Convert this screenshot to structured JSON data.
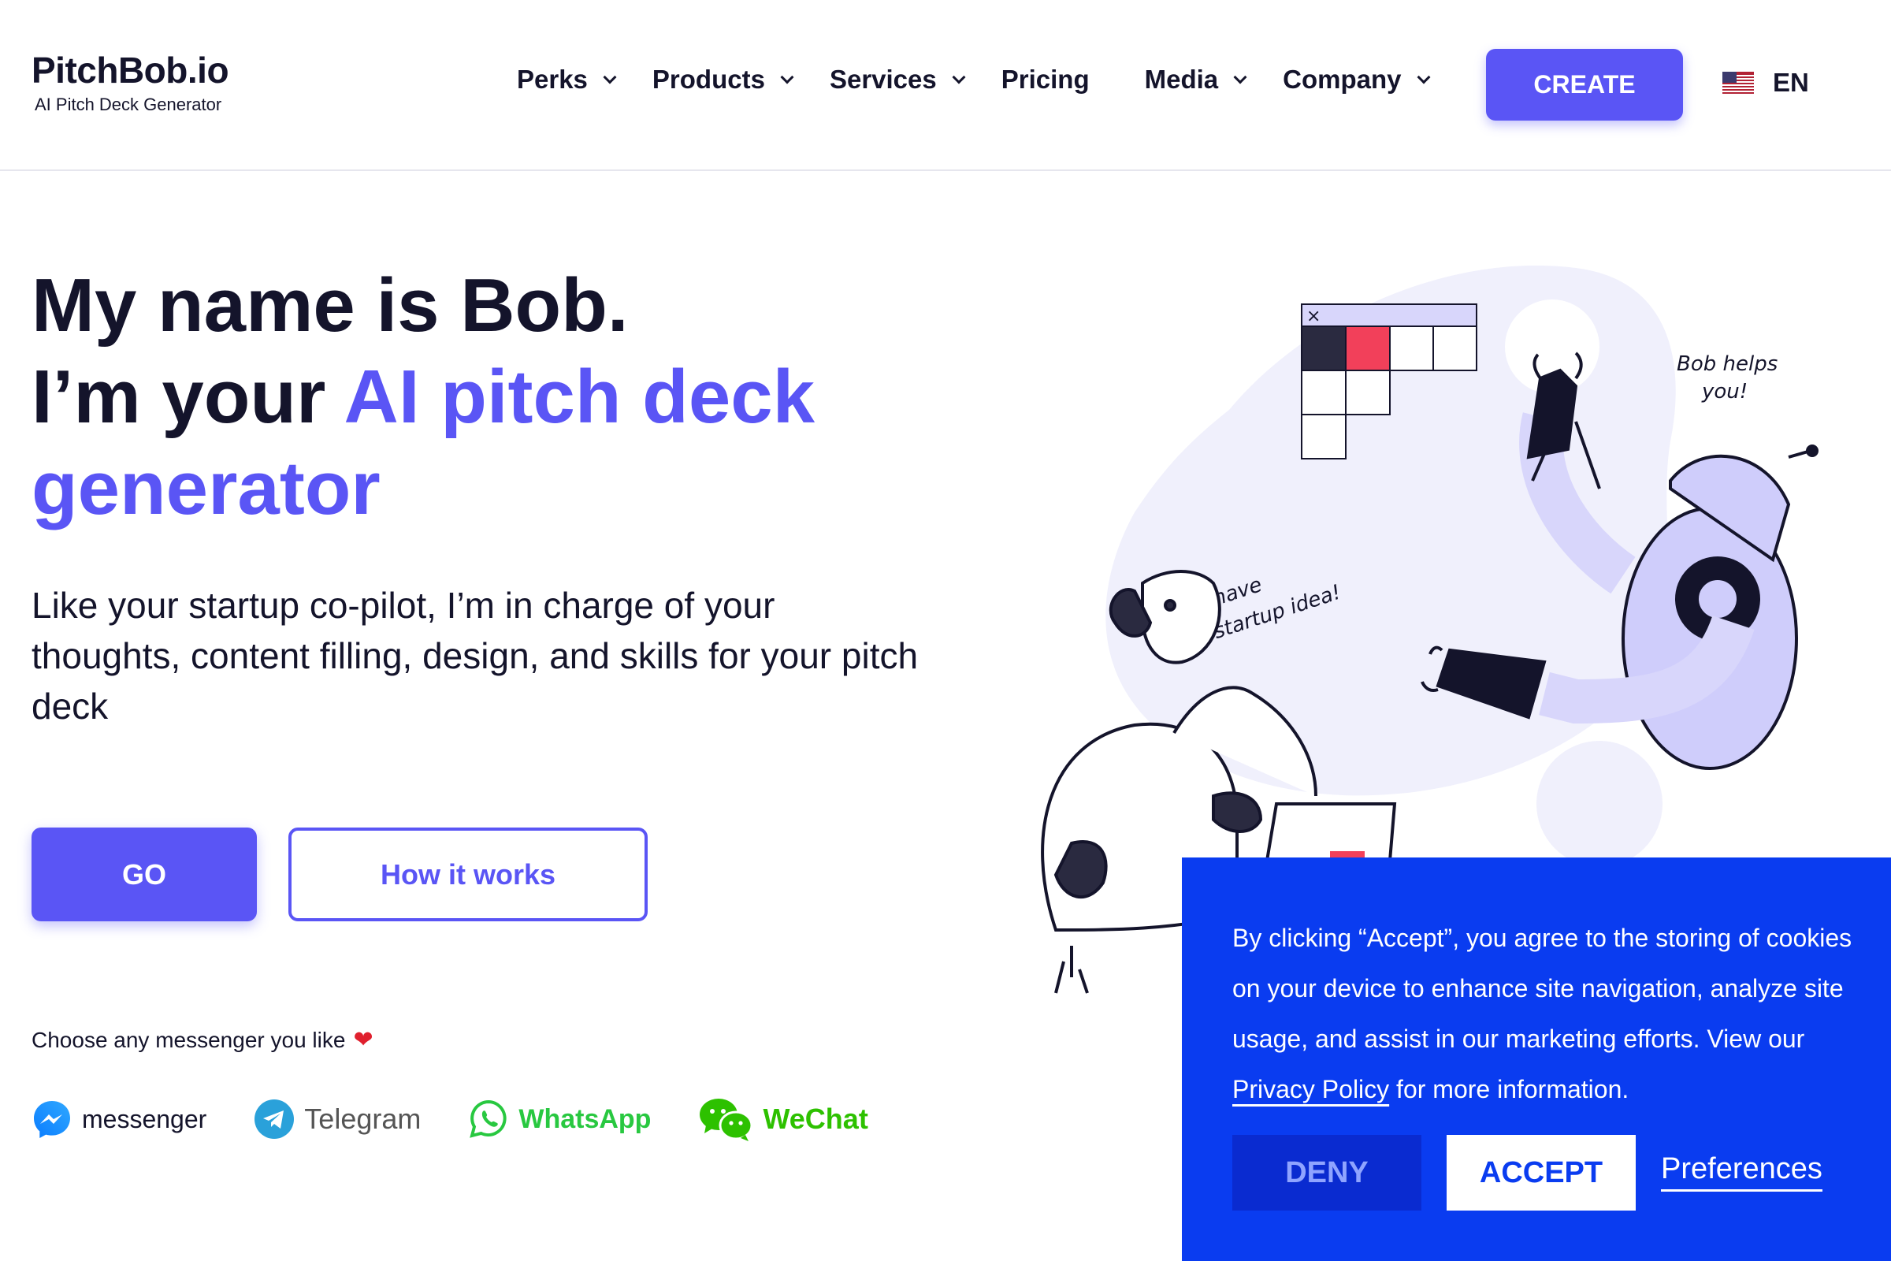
{
  "brand": {
    "name": "PitchBob.io",
    "tagline": "AI Pitch Deck Generator"
  },
  "nav": {
    "items": [
      {
        "label": "Perks",
        "has_dropdown": true
      },
      {
        "label": "Products",
        "has_dropdown": true
      },
      {
        "label": "Services",
        "has_dropdown": true
      },
      {
        "label": "Pricing",
        "has_dropdown": false
      },
      {
        "label": "Media",
        "has_dropdown": true
      },
      {
        "label": "Company",
        "has_dropdown": true
      }
    ],
    "create_label": "CREATE",
    "language": "EN"
  },
  "hero": {
    "line1": "My name is Bob.",
    "line2_prefix": "I’m your ",
    "line2_accent": "AI pitch deck",
    "line3_accent": "generator",
    "description": "Like your startup co-pilot, I’m in charge of your thoughts, content filling, design, and skills for your pitch deck",
    "go_label": "GO",
    "how_label": "How it works"
  },
  "messengers": {
    "note": "Choose any messenger you like",
    "items": [
      {
        "label": "messenger",
        "icon": "facebook-messenger-icon"
      },
      {
        "label": "Telegram",
        "icon": "telegram-icon"
      },
      {
        "label": "WhatsApp",
        "icon": "whatsapp-icon"
      },
      {
        "label": "WeChat",
        "icon": "wechat-icon"
      }
    ]
  },
  "illustration": {
    "bubble_person": "I have a startup idea!",
    "bubble_robot": "Bob helps you!"
  },
  "cookie": {
    "text_before": "By clicking “Accept”, you agree to the storing of cookies on your device to enhance site navigation, analyze site usage, and assist in our marketing efforts. View our ",
    "link": "Privacy Policy",
    "text_after": " for more information.",
    "deny_label": "DENY",
    "accept_label": "ACCEPT",
    "preferences_label": "Preferences"
  },
  "colors": {
    "accent": "#5a55f5",
    "cookie_bg": "#0a3cf0",
    "text": "#14142b"
  }
}
